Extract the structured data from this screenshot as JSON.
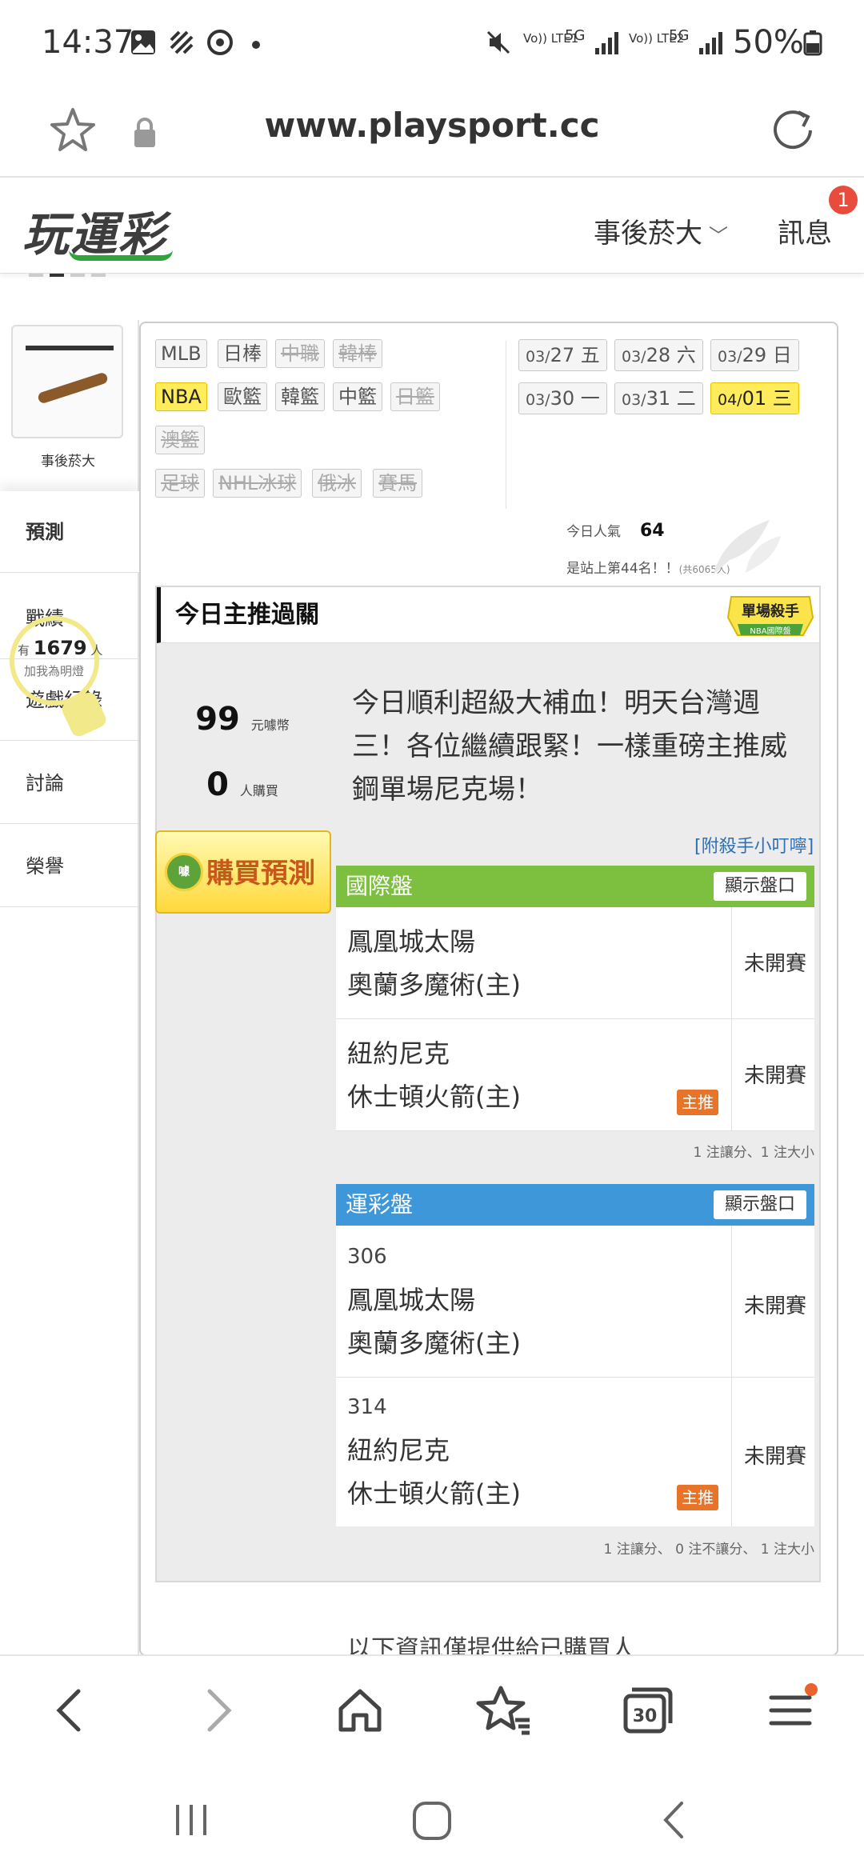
{
  "status_bar": {
    "time": "14:37",
    "indicators": [
      "Vo)) LTE1",
      "5G",
      "Vo)) LTE2",
      "5G"
    ],
    "battery": "50%"
  },
  "browser": {
    "url": "www.playsport.cc",
    "tabs_count": "30"
  },
  "header": {
    "logo": "玩運彩",
    "user_menu": "事後菸大",
    "messages_label": "訊息",
    "messages_badge": "1"
  },
  "sidebar": {
    "profile_name": "事後菸大",
    "items": [
      {
        "label": "預測",
        "active": true
      },
      {
        "label": "戰績"
      },
      {
        "label": "遊戲紀錄"
      },
      {
        "label": "討論"
      },
      {
        "label": "榮譽"
      }
    ],
    "fans_prefix": "有",
    "fans_count": "1679",
    "fans_suffix": "人",
    "fans_caption": "加我為明燈"
  },
  "sports": {
    "tags": [
      {
        "label": "MLB",
        "state": "normal"
      },
      {
        "label": "日棒",
        "state": "normal"
      },
      {
        "label": "中職",
        "state": "off"
      },
      {
        "label": "韓棒",
        "state": "off"
      },
      {
        "label": "NBA",
        "state": "selected"
      },
      {
        "label": "歐籃",
        "state": "normal"
      },
      {
        "label": "韓籃",
        "state": "normal"
      },
      {
        "label": "中籃",
        "state": "normal"
      },
      {
        "label": "日籃",
        "state": "off"
      },
      {
        "label": "澳籃",
        "state": "off"
      },
      {
        "label": "足球",
        "state": "off"
      },
      {
        "label": "NHL冰球",
        "state": "off"
      },
      {
        "label": "俄冰",
        "state": "off"
      },
      {
        "label": "賽馬",
        "state": "off"
      }
    ]
  },
  "dates": [
    {
      "md": "03/",
      "day": "27",
      "wd": "五"
    },
    {
      "md": "03/",
      "day": "28",
      "wd": "六"
    },
    {
      "md": "03/",
      "day": "29",
      "wd": "日"
    },
    {
      "md": "03/",
      "day": "30",
      "wd": "一"
    },
    {
      "md": "03/",
      "day": "31",
      "wd": "二"
    },
    {
      "md": "04/",
      "day": "01",
      "wd": "三",
      "selected": true
    }
  ],
  "popularity": {
    "label": "今日人氣",
    "value": "64",
    "rank_text": "是站上第44名！！",
    "rank_note": "(共6065人)"
  },
  "pick_card": {
    "title": "今日主推過關",
    "badge_text": "單場殺手",
    "badge_sub": "NBA國際盤",
    "price_value": "99",
    "price_unit": "元噱幣",
    "buyers_value": "0",
    "buyers_unit": "人購買",
    "buy_button": "購買預測",
    "buy_coin": "噱",
    "message": "今日順利超級大補血！明天台灣週三！各位繼續跟緊！一樣重磅主推威鋼單場尼克場！",
    "tips_link": "[附殺手小叮嚀]"
  },
  "intl_table": {
    "header": "國際盤",
    "header_color": "#7dbf3f",
    "show_button": "顯示盤口",
    "rows": [
      {
        "away": "鳳凰城太陽",
        "home": "奧蘭多魔術(主)",
        "status": "未開賽",
        "featured": false
      },
      {
        "away": "紐約尼克",
        "home": "休士頓火箭(主)",
        "status": "未開賽",
        "featured": true
      }
    ],
    "note": "1 注讓分、1 注大小"
  },
  "sports_table": {
    "header": "運彩盤",
    "header_color": "#3d97d8",
    "show_button": "顯示盤口",
    "rows": [
      {
        "no": "306",
        "away": "鳳凰城太陽",
        "home": "奧蘭多魔術(主)",
        "status": "未開賽",
        "featured": false
      },
      {
        "no": "314",
        "away": "紐約尼克",
        "home": "休士頓火箭(主)",
        "status": "未開賽",
        "featured": true
      }
    ],
    "note": "1 注讓分、 0 注不讓分、 1 注大小"
  },
  "featured_label": "主推",
  "footer_text": "以下資訊僅提供給已購買人"
}
